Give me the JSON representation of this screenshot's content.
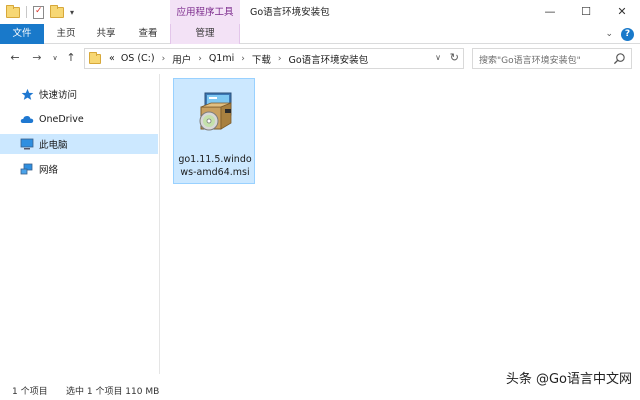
{
  "title_bar": {
    "context_tab_group": "应用程序工具",
    "window_title": "Go语言环境安装包",
    "qat_dropdown": "▾",
    "minimize": "—",
    "maximize": "☐",
    "close": "✕"
  },
  "ribbon": {
    "tabs": [
      "文件",
      "主页",
      "共享",
      "查看",
      "管理"
    ],
    "collapse": "⌄",
    "help": "?"
  },
  "address": {
    "overflow": "«",
    "crumbs": [
      "OS (C:)",
      "用户",
      "Q1mi",
      "下载",
      "Go语言环境安装包"
    ],
    "separator": "›"
  },
  "search": {
    "placeholder": "搜索\"Go语言环境安装包\""
  },
  "nav_pane": {
    "items": [
      {
        "label": "快速访问",
        "icon": "star-icon"
      },
      {
        "label": "OneDrive",
        "icon": "onedrive-cloud-icon"
      },
      {
        "label": "此电脑",
        "icon": "computer-icon",
        "selected": true
      },
      {
        "label": "网络",
        "icon": "network-icon"
      }
    ]
  },
  "files": [
    {
      "name": "go1.11.5.windows-amd64.msi",
      "icon": "msi-installer-icon",
      "selected": true
    }
  ],
  "status": {
    "count": "1 个项目",
    "selection": "选中 1 个项目  110 MB"
  },
  "watermark": "头条 @Go语言中文网",
  "colors": {
    "file_tab": "#1979ca",
    "context_tab": "#f3e2f6",
    "selection": "#cce8ff"
  }
}
